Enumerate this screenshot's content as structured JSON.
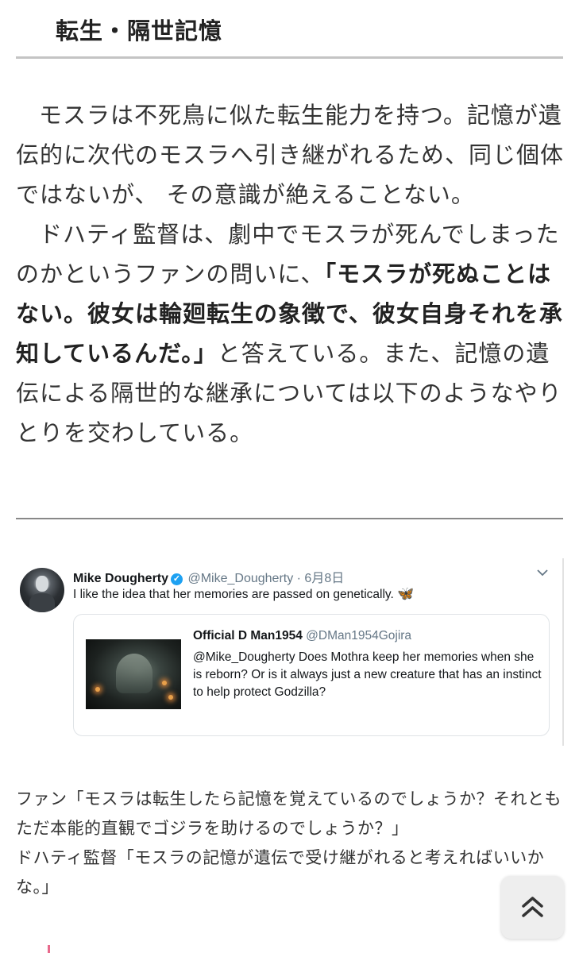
{
  "heading": "転生・隔世記憶",
  "article": {
    "p1": "モスラは不死鳥に似た転生能力を持つ。記憶が遺伝的に次代のモスラへ引き継がれるため、同じ個体ではないが、 その意識が絶えることない。",
    "p2_pre": "ドハティ監督は、劇中でモスラが死んでしまったのかというファンの問いに、",
    "p2_bold": "「モスラが死ぬことはない。彼女は輪廻転生の象徴で、彼女自身それを承知しているんだ。」",
    "p2_post": "と答えている。また、記憶の遺伝による隔世的な継承については以下のようなやりとりを交わしている。"
  },
  "tweet": {
    "name": "Mike Dougherty",
    "handle_date": "@Mike_Dougherty · 6月8日",
    "text": "I like the idea that her memories are passed on genetically.",
    "emoji": "🦋",
    "quote": {
      "name": "Official D Man1954",
      "handle": "@DMan1954Gojira",
      "text": "@Mike_Dougherty Does Mothra keep her memories when she is reborn? Or is it always just a new creature that has an instinct to help protect Godzilla?"
    }
  },
  "dialogue": {
    "line1": "ファン「モスラは転生したら記憶を覚えているのでしょうか？それともただ本能的直観でゴジラを助けるのでしょうか？」",
    "line2": "ドハティ監督「モスラの記憶が遺伝で受け継がれると考えればいいかな。」"
  },
  "icons": {
    "verified": "verified-badge-icon",
    "chevron": "chevron-down-icon",
    "scroll_top": "double-chevron-up-icon"
  },
  "colors": {
    "accent_blue": "#1da1f2",
    "pink_mark": "#e86a8c"
  }
}
